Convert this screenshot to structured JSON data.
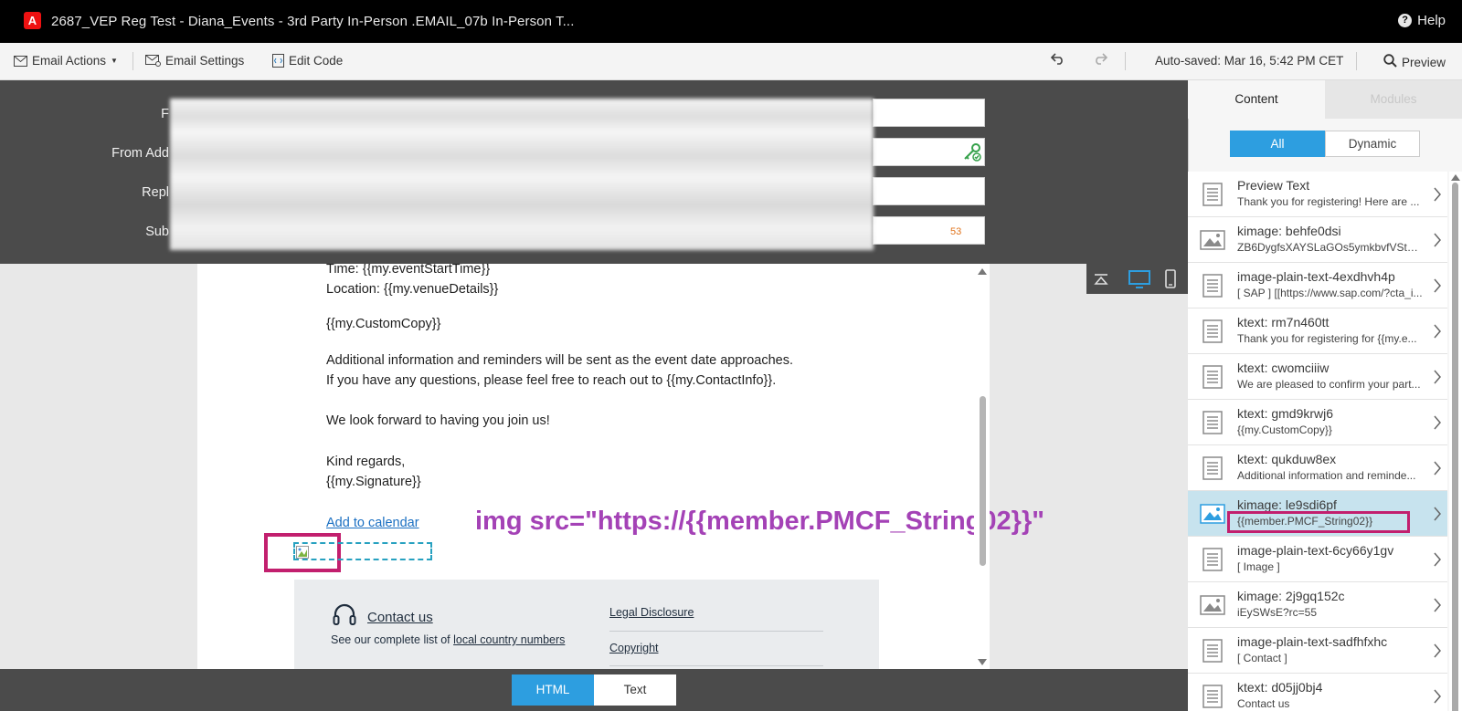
{
  "app": {
    "title": "2687_VEP Reg Test - Diana_Events - 3rd Party In-Person .EMAIL_07b In-Person T...",
    "help_label": "Help",
    "logo_letter": "A"
  },
  "toolbar": {
    "email_actions": "Email Actions",
    "email_settings": "Email Settings",
    "edit_code": "Edit Code",
    "autosaved": "Auto-saved: Mar 16, 5:42 PM CET",
    "preview": "Preview"
  },
  "header": {
    "from_label": "F",
    "from_address_label": "From Add",
    "reply_label": "Repl",
    "subject_label": "Sub",
    "subject_char_count": "53"
  },
  "email": {
    "time_line": "Time: {{my.eventStartTime}}",
    "location_line": "Location: {{my.venueDetails}}",
    "custom_copy": "{{my.CustomCopy}}",
    "info_line1": "Additional information and reminders will be sent as the event date approaches.",
    "info_line2": "If you have any questions, please feel free to reach out to {{my.ContactInfo}}.",
    "look_forward": "We look forward to having you join us!",
    "kind_regards": "Kind regards,",
    "signature": "{{my.Signature}}",
    "add_to_calendar": "Add to calendar"
  },
  "annotation": {
    "text": "img src=\"https://{{member.PMCF_String02}}\"",
    "color": "#a442b6",
    "box_color": "#c21f6e"
  },
  "footer": {
    "contact_us": "Contact us",
    "see_list": "See our complete list of ",
    "local_numbers": "local country numbers",
    "legal": "Legal Disclosure",
    "copyright": "Copyright"
  },
  "bottom": {
    "html_label": "HTML",
    "text_label": "Text",
    "active_color": "#2d9ee0"
  },
  "panel": {
    "tab_content": "Content",
    "tab_modules": "Modules",
    "seg_all": "All",
    "seg_dynamic": "Dynamic",
    "items": [
      {
        "icon": "text-icon",
        "title": "Preview Text",
        "sub": "Thank you for registering! Here are ..."
      },
      {
        "icon": "image-icon",
        "title": "kimage: behfe0dsi",
        "sub": "ZB6DygfsXAYSLaGOs5ymkbvfVStDPI..."
      },
      {
        "icon": "text-icon",
        "title": "image-plain-text-4exdhvh4p",
        "sub": "[ SAP ] [[https://www.sap.com/?cta_i..."
      },
      {
        "icon": "text-icon",
        "title": "ktext: rm7n460tt",
        "sub": "Thank you for registering for {{my.e..."
      },
      {
        "icon": "text-icon",
        "title": "ktext: cwomciiiw",
        "sub": "We are pleased to confirm your part..."
      },
      {
        "icon": "text-icon",
        "title": "ktext: gmd9krwj6",
        "sub": "{{my.CustomCopy}}"
      },
      {
        "icon": "text-icon",
        "title": "ktext: qukduw8ex",
        "sub": "Additional information and reminde..."
      },
      {
        "icon": "image-icon",
        "title": "kimage: le9sdi6pf",
        "sub": "{{member.PMCF_String02}}",
        "selected": true
      },
      {
        "icon": "text-icon",
        "title": "image-plain-text-6cy66y1gv",
        "sub": "[ Image ]"
      },
      {
        "icon": "image-icon",
        "title": "kimage: 2j9gq152c",
        "sub": "iEySWsE?rc=55"
      },
      {
        "icon": "text-icon",
        "title": "image-plain-text-sadfhfxhc",
        "sub": "[ Contact ]"
      },
      {
        "icon": "text-icon",
        "title": "ktext: d05jj0bj4",
        "sub": "Contact us"
      }
    ]
  }
}
